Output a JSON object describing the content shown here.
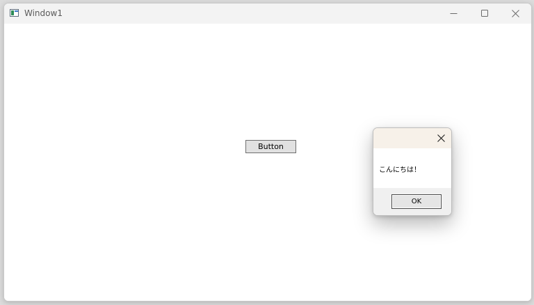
{
  "window": {
    "title": "Window1",
    "icon": "application-window-icon"
  },
  "main": {
    "button_label": "Button"
  },
  "dialog": {
    "message": "こんにちは！",
    "ok_label": "OK",
    "close_icon": "close-icon"
  },
  "colors": {
    "titlebar": "#f3f3f3",
    "dialog_titlebar": "#f7f1e9",
    "button_face": "#e1e1e1",
    "dialog_footer": "#f0f0f0"
  }
}
